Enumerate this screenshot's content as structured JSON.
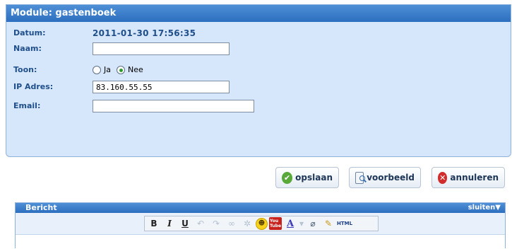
{
  "module": {
    "title": "Module: gastenboek",
    "fields": {
      "datum_label": "Datum:",
      "datum_value": "2011-01-30 17:56:35",
      "naam_label": "Naam:",
      "naam_value": "",
      "toon_label": "Toon:",
      "toon_options": [
        "Ja",
        "Nee"
      ],
      "toon_selected": "Nee",
      "ip_label": "IP Adres:",
      "ip_value": "83.160.55.55",
      "email_label": "Email:",
      "email_value": ""
    }
  },
  "buttons": {
    "save": "opslaan",
    "preview": "voorbeeld",
    "cancel": "annuleren"
  },
  "bericht": {
    "title": "Bericht",
    "close": "sluiten▼",
    "toolbar": [
      "bold-icon",
      "italic-icon",
      "underline-icon",
      "undo-icon",
      "redo-icon",
      "link-icon",
      "unlink-icon",
      "smiley-icon",
      "youtube-icon",
      "font-color-icon",
      "eraser-icon",
      "brush-icon",
      "html-icon"
    ]
  }
}
